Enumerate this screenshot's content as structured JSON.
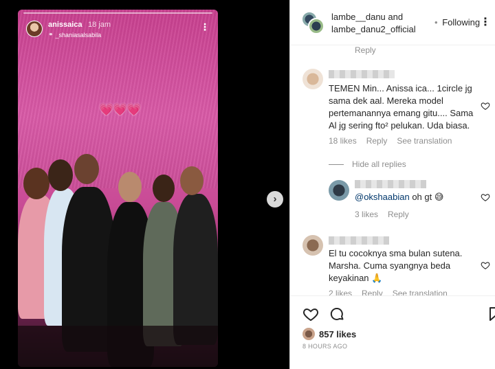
{
  "story": {
    "username": "anissaica",
    "time": "18 jam",
    "sub_user": "_shaniasalsabila",
    "hearts": "💗💗💗"
  },
  "header": {
    "user1": "lambe__danu",
    "and": " and",
    "user2": "lambe_danu2_official",
    "dot": "•",
    "following": "Following",
    "more": "⋮"
  },
  "comments": {
    "top_reply": "Reply",
    "items": [
      {
        "text": "TEMEN Min... Anissa ica... 1circle jg sama dek aal. Mereka model pertemanannya emang gitu.... Sama Al jg sering fto² pelukan. Uda biasa.",
        "likes": "18 likes",
        "reply": "Reply",
        "translate": "See translation"
      },
      {
        "mention": "@okshaabian",
        "text": " oh gt 😅",
        "likes": "3 likes",
        "reply": "Reply"
      },
      {
        "text": "El tu cocoknya sma bulan sutena. Marsha. Cuma syangnya beda keyakinan 🙏",
        "likes": "2 likes",
        "reply": "Reply",
        "translate": "See translation"
      }
    ],
    "hide_replies": "Hide all replies"
  },
  "actions": {
    "likes": "857 likes",
    "time_ago": "8 HOURS AGO"
  },
  "colors": {
    "accent_link": "#00376b",
    "muted": "#8e8e8e",
    "text": "#262626"
  }
}
